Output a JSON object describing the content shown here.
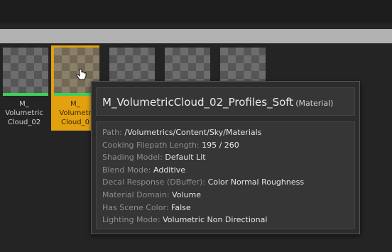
{
  "assets": [
    {
      "label": "M_\nVolumetric\nCloud_02",
      "selected": false
    },
    {
      "label": "M_\nVolumetr\nCloud_0",
      "selected": true
    },
    {
      "label": "",
      "selected": false
    },
    {
      "label": "",
      "selected": false
    },
    {
      "label": "",
      "selected": false
    }
  ],
  "tooltip": {
    "title": "M_VolumetricCloud_02_Profiles_Soft",
    "type": "(Material)",
    "properties": [
      {
        "key": "Path:",
        "value": "/Volumetrics/Content/Sky/Materials"
      },
      {
        "key": "Cooking Filepath Length:",
        "value": "195 / 260"
      },
      {
        "key": "Shading Model:",
        "value": "Default Lit"
      },
      {
        "key": "Blend Mode:",
        "value": "Additive"
      },
      {
        "key": "Decal Response (DBuffer):",
        "value": "Color Normal Roughness"
      },
      {
        "key": "Material Domain:",
        "value": "Volume"
      },
      {
        "key": "Has Scene Color:",
        "value": "False"
      },
      {
        "key": "Lighting Mode:",
        "value": "Volumetric Non Directional"
      }
    ]
  },
  "colors": {
    "selected": "#e3a110",
    "status_bar": "#3bd15a"
  },
  "icons": {
    "cursor": "hand-pointer-icon"
  }
}
